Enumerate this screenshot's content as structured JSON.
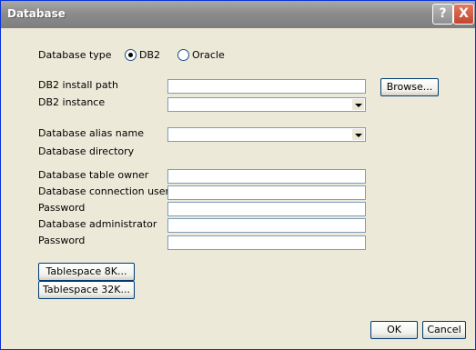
{
  "window": {
    "title": "Database",
    "help_label": "?",
    "close_label": "X"
  },
  "db_type": {
    "label": "Database type",
    "options": [
      "DB2",
      "Oracle"
    ],
    "selected": "DB2"
  },
  "fields": {
    "install_path": {
      "label": "DB2 install path",
      "value": ""
    },
    "browse": "Browse...",
    "instance": {
      "label": "DB2 instance",
      "value": ""
    },
    "alias": {
      "label": "Database alias name",
      "value": ""
    },
    "directory": {
      "label": "Database directory"
    },
    "table_owner": {
      "label": "Database table owner",
      "value": ""
    },
    "conn_user": {
      "label": "Database connection user",
      "value": ""
    },
    "password1": {
      "label": "Password",
      "value": ""
    },
    "admin": {
      "label": "Database administrator",
      "value": ""
    },
    "password2": {
      "label": "Password",
      "value": ""
    }
  },
  "tablespace": {
    "btn8k": "Tablespace 8K...",
    "btn32k": "Tablespace 32K..."
  },
  "footer": {
    "ok": "OK",
    "cancel": "Cancel"
  },
  "colors": {
    "title_bar": "#8C8C8C",
    "dialog_bg": "#ECE9D8",
    "field_border": "#7F9DB9",
    "close_btn": "#C0462E"
  },
  "icons": {
    "help": "help-icon",
    "close": "close-icon",
    "combo_arrow": "chevron-down-icon"
  }
}
